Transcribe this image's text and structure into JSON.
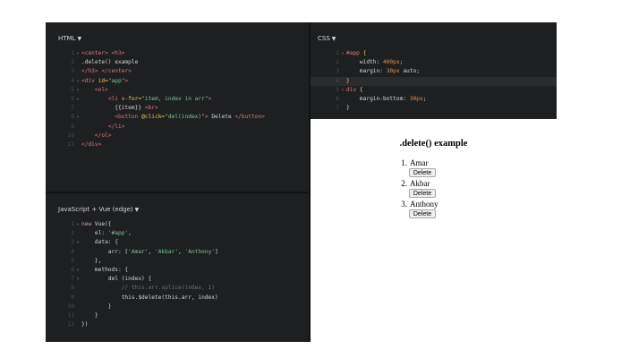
{
  "panes": {
    "html_title": "HTML",
    "css_title": "CSS",
    "js_title": "JavaScript + Vue (edge)"
  },
  "html_code": [
    {
      "n": "1",
      "fold": "▾",
      "parts": [
        [
          "tag",
          "<center>"
        ],
        [
          "tx",
          " "
        ],
        [
          "tag",
          "<h3>"
        ]
      ]
    },
    {
      "n": "2",
      "fold": "",
      "parts": [
        [
          "tx",
          ".delete() example"
        ]
      ]
    },
    {
      "n": "3",
      "fold": "",
      "parts": [
        [
          "tag",
          "</h3>"
        ],
        [
          "tx",
          " "
        ],
        [
          "tag",
          "</center>"
        ]
      ]
    },
    {
      "n": "4",
      "fold": "▾",
      "parts": [
        [
          "tag",
          "<div "
        ],
        [
          "attr",
          "id="
        ],
        [
          "str",
          "\"app\""
        ],
        [
          "tag",
          ">"
        ]
      ]
    },
    {
      "n": "5",
      "fold": "▾",
      "parts": [
        [
          "tx",
          "    "
        ],
        [
          "tag",
          "<ol>"
        ]
      ]
    },
    {
      "n": "6",
      "fold": "▾",
      "parts": [
        [
          "tx",
          "        "
        ],
        [
          "tag",
          "<li "
        ],
        [
          "attr",
          "v-for="
        ],
        [
          "str",
          "\"item, index in arr\""
        ],
        [
          "tag",
          ">"
        ]
      ]
    },
    {
      "n": "7",
      "fold": "",
      "parts": [
        [
          "tx",
          "          {{item}} "
        ],
        [
          "tag",
          "<br>"
        ]
      ]
    },
    {
      "n": "8",
      "fold": "▾",
      "parts": [
        [
          "tx",
          "          "
        ],
        [
          "tag",
          "<button "
        ],
        [
          "attr",
          "@click="
        ],
        [
          "str",
          "\"del(index)\""
        ],
        [
          "tag",
          ">"
        ],
        [
          "tx",
          " Delete "
        ],
        [
          "tag",
          "</button>"
        ]
      ]
    },
    {
      "n": "9",
      "fold": "",
      "parts": [
        [
          "tx",
          "        "
        ],
        [
          "tag",
          "</li>"
        ]
      ]
    },
    {
      "n": "10",
      "fold": "",
      "parts": [
        [
          "tx",
          "    "
        ],
        [
          "tag",
          "</ol>"
        ]
      ]
    },
    {
      "n": "11",
      "fold": "",
      "parts": [
        [
          "tag",
          "</div>"
        ]
      ]
    }
  ],
  "css_code": [
    {
      "n": "1",
      "fold": "▾",
      "parts": [
        [
          "tag",
          "#app "
        ],
        [
          "attr",
          "{"
        ]
      ]
    },
    {
      "n": "2",
      "fold": "",
      "parts": [
        [
          "tx",
          "    width: "
        ],
        [
          "num",
          "400px"
        ],
        [
          "tx",
          ";"
        ]
      ]
    },
    {
      "n": "3",
      "fold": "",
      "parts": [
        [
          "tx",
          "    margin: "
        ],
        [
          "num",
          "30px"
        ],
        [
          "tx",
          " auto;"
        ]
      ]
    },
    {
      "n": "4",
      "fold": "",
      "hl": true,
      "parts": [
        [
          "attr",
          "}"
        ]
      ]
    },
    {
      "n": "5",
      "fold": "▾",
      "parts": [
        [
          "tag",
          "div "
        ],
        [
          "tx",
          "{"
        ]
      ]
    },
    {
      "n": "6",
      "fold": "",
      "parts": [
        [
          "tx",
          "    margin-bottom: "
        ],
        [
          "num",
          "30px"
        ],
        [
          "tx",
          ";"
        ]
      ]
    },
    {
      "n": "7",
      "fold": "",
      "parts": [
        [
          "tx",
          "}"
        ]
      ]
    }
  ],
  "js_code": [
    {
      "n": "1",
      "fold": "▾",
      "parts": [
        [
          "kw",
          "new "
        ],
        [
          "tx",
          "Vue({"
        ]
      ]
    },
    {
      "n": "2",
      "fold": "",
      "parts": [
        [
          "tx",
          "    el: "
        ],
        [
          "str",
          "'#app'"
        ],
        [
          "tx",
          ","
        ]
      ]
    },
    {
      "n": "3",
      "fold": "▾",
      "parts": [
        [
          "tx",
          "    data: {"
        ]
      ]
    },
    {
      "n": "4",
      "fold": "",
      "parts": [
        [
          "tx",
          "        arr: ["
        ],
        [
          "str",
          "'Amar'"
        ],
        [
          "tx",
          ", "
        ],
        [
          "str",
          "'Akbar'"
        ],
        [
          "tx",
          ", "
        ],
        [
          "str",
          "'Anthony'"
        ],
        [
          "tx",
          "]"
        ]
      ]
    },
    {
      "n": "5",
      "fold": "",
      "parts": [
        [
          "tx",
          "    },"
        ]
      ]
    },
    {
      "n": "6",
      "fold": "▾",
      "parts": [
        [
          "tx",
          "    methods: {"
        ]
      ]
    },
    {
      "n": "7",
      "fold": "▾",
      "parts": [
        [
          "tx",
          "        del (index) {"
        ]
      ]
    },
    {
      "n": "8",
      "fold": "",
      "parts": [
        [
          "cm",
          "            // this.arr.splice(index, 1)"
        ]
      ]
    },
    {
      "n": "9",
      "fold": "",
      "parts": [
        [
          "tx",
          "            this.$delete(this.arr, index)"
        ]
      ]
    },
    {
      "n": "10",
      "fold": "",
      "parts": [
        [
          "tx",
          "        }"
        ]
      ]
    },
    {
      "n": "11",
      "fold": "",
      "parts": [
        [
          "tx",
          "    }"
        ]
      ]
    },
    {
      "n": "12",
      "fold": "",
      "parts": [
        [
          "tx",
          "})"
        ]
      ]
    }
  ],
  "result": {
    "heading": ".delete() example",
    "items": [
      {
        "num": "1.",
        "name": "Amar",
        "button": "Delete"
      },
      {
        "num": "2.",
        "name": "Akbar",
        "button": "Delete"
      },
      {
        "num": "3.",
        "name": "Anthony",
        "button": "Delete"
      }
    ]
  }
}
